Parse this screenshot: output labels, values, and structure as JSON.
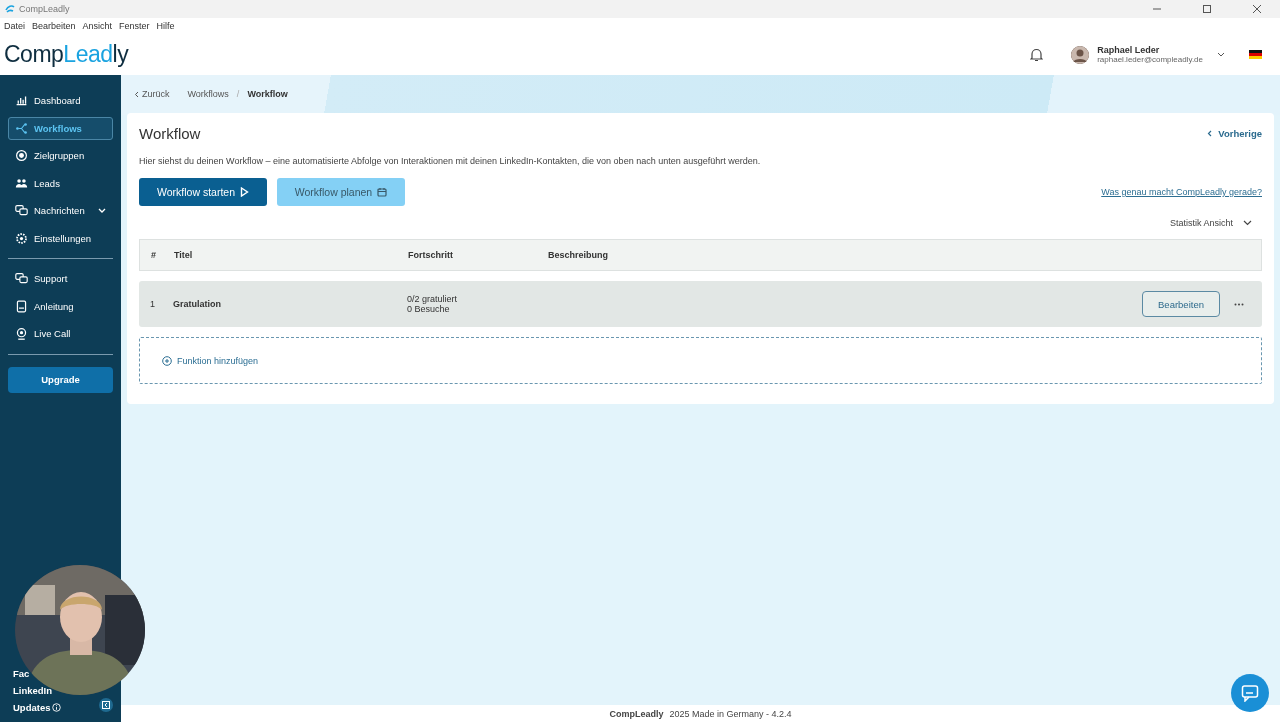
{
  "window": {
    "title": "CompLeadly"
  },
  "menu": [
    "Datei",
    "Bearbeiten",
    "Ansicht",
    "Fenster",
    "Hilfe"
  ],
  "logo": [
    {
      "text": "Comp",
      "accent": false
    },
    {
      "text": "Lead",
      "accent": true
    },
    {
      "text": "ly",
      "accent": false
    }
  ],
  "user": {
    "name": "Raphael Leder",
    "email": "raphael.leder@compleadly.de"
  },
  "sidebar": {
    "items": [
      {
        "label": "Dashboard",
        "selected": false,
        "expandable": false
      },
      {
        "label": "Workflows",
        "selected": true,
        "expandable": false
      },
      {
        "label": "Zielgruppen",
        "selected": false,
        "expandable": false
      },
      {
        "label": "Leads",
        "selected": false,
        "expandable": false
      },
      {
        "label": "Nachrichten",
        "selected": false,
        "expandable": true
      },
      {
        "label": "Einstellungen",
        "selected": false,
        "expandable": false
      }
    ],
    "support_items": [
      {
        "label": "Support",
        "selected": false,
        "expandable": false
      },
      {
        "label": "Anleitung",
        "selected": false,
        "expandable": false
      },
      {
        "label": "Live Call",
        "selected": false,
        "expandable": false
      }
    ],
    "upgrade": "Upgrade",
    "bottom_links": [
      "Fac",
      "LinkedIn",
      "Updates"
    ]
  },
  "breadcrumb": {
    "back": "Zurück",
    "items": [
      "Workflows",
      "Workflow"
    ],
    "separator": "/"
  },
  "card": {
    "title": "Workflow",
    "previous": "Vorherige",
    "description": "Hier siehst du deinen Workflow – eine automatisierte Abfolge von Interaktionen mit deinen LinkedIn-Kontakten, die von oben nach unten ausgeführt werden.",
    "start_button": "Workflow starten",
    "plan_button": "Workflow planen",
    "help_link": "Was genau macht CompLeadly gerade?",
    "view_select": "Statistik Ansicht"
  },
  "table": {
    "columns": [
      "#",
      "Titel",
      "Fortschritt",
      "Beschreibung"
    ],
    "rows": [
      {
        "index": "1",
        "title": "Gratulation",
        "progress": [
          "0/2 gratuliert",
          "0 Besuche"
        ],
        "edit": "Bearbeiten"
      }
    ],
    "add": "Funktion hinzufügen"
  },
  "footer": {
    "brand": "CompLeadly",
    "text": "2025 Made in Germany - 4.2.4"
  },
  "webcam": {
    "kind": "picture"
  }
}
